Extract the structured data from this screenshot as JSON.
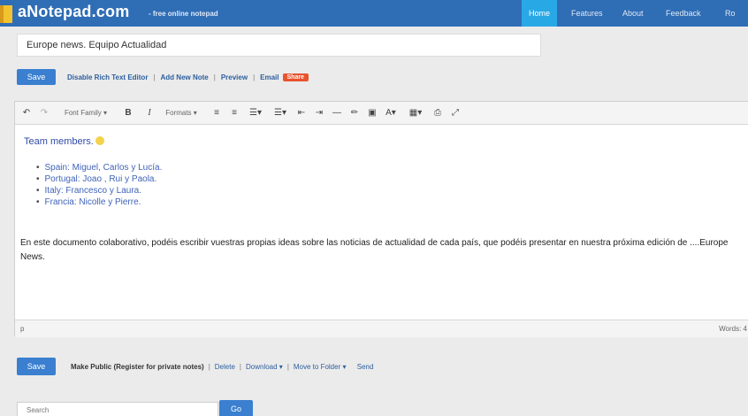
{
  "header": {
    "brand": "aNotepad.com",
    "tagline": "- free online notepad",
    "nav": [
      "Home",
      "Features",
      "About",
      "Feedback",
      "Ro"
    ]
  },
  "note": {
    "title": "Europe news. Equipo Actualidad"
  },
  "actions": {
    "save_label": "Save",
    "links": [
      "Disable Rich Text Editor",
      "Add New Note",
      "Preview",
      "Email"
    ],
    "share_label": "Share"
  },
  "toolbar": {
    "undo_icon": "undo-icon",
    "redo_icon": "redo-icon",
    "font_family": "Font Family",
    "bold": "B",
    "italic": "I",
    "formats": "Formats"
  },
  "content": {
    "team_title": "Team members.",
    "members": [
      "Spain: Miguel, Carlos y Lucía.",
      "Portugal: Joao , Rui y Paola.",
      "Italy: Francesco y Laura.",
      "Francia: Nicolle y Pierre."
    ],
    "paragraph": "En este documento colaborativo, podéis escribir vuestras propias ideas sobre las noticias de actualidad de cada país, que podéis presentar en nuestra próxima edición de ....Europe News."
  },
  "statusbar": {
    "path": "p",
    "words": "Words: 4"
  },
  "bottom": {
    "save_label": "Save",
    "make_public": "Make Public (Register for private notes)",
    "delete": "Delete",
    "download": "Download",
    "move": "Move to Folder",
    "send": "Send"
  },
  "search": {
    "placeholder": "Search",
    "button": "Go"
  },
  "colors": {
    "header_bg": "#2f6db5",
    "nav_active": "#29a8e6",
    "button_blue": "#3a7fd0",
    "share_orange": "#e8532e"
  }
}
